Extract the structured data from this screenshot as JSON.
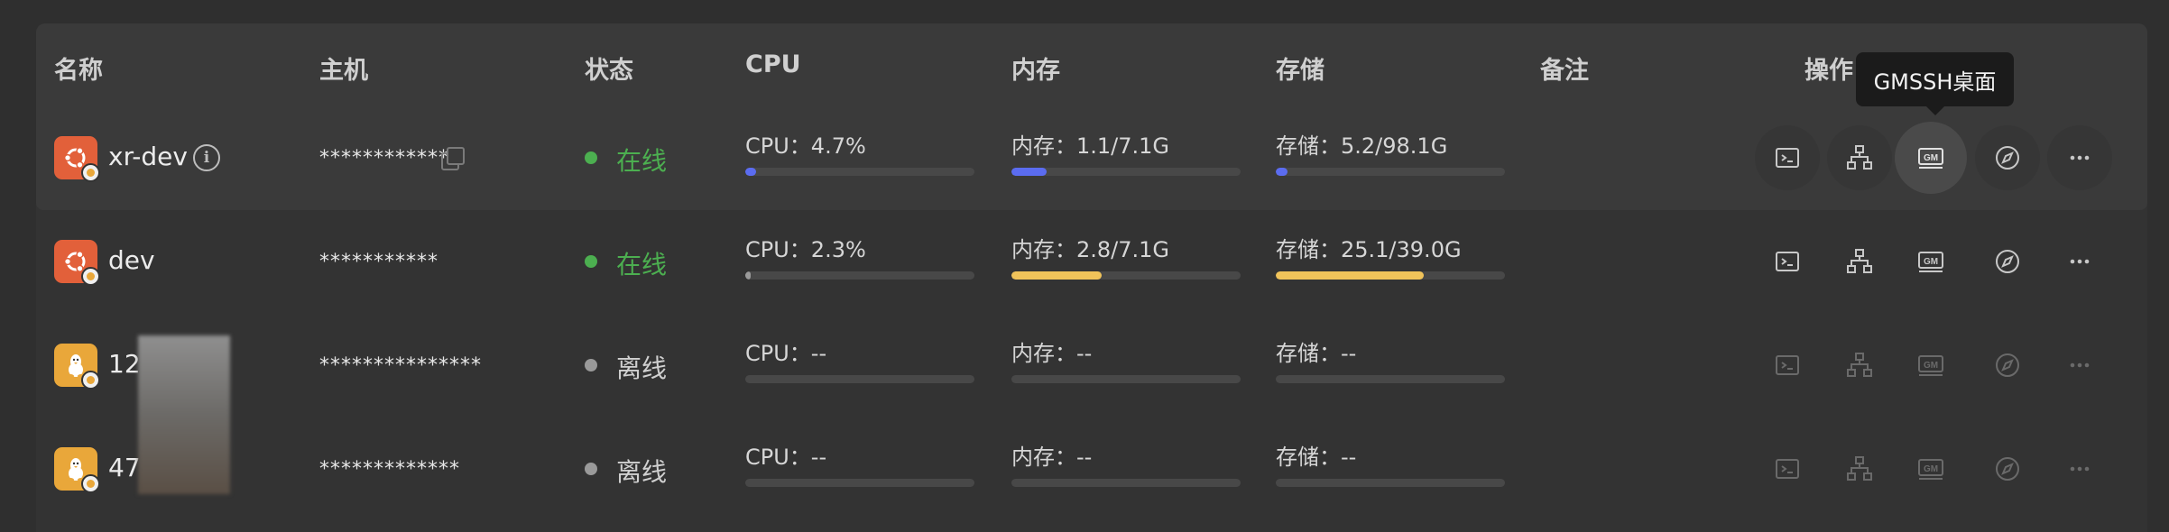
{
  "columns": {
    "name": "名称",
    "host": "主机",
    "status": "状态",
    "cpu": "CPU",
    "memory": "内存",
    "storage": "存储",
    "remark": "备注",
    "actions": "操作"
  },
  "tooltip": "GMSSH桌面",
  "colors": {
    "online": "#4caf50",
    "offline": "#9a9a9a",
    "bar_blue": "#5b6cf0",
    "bar_yellow": "#f0c35a",
    "bar_track": "#484848"
  },
  "rows": [
    {
      "os": "ubuntu-icon",
      "name": "xr-dev",
      "host": "************",
      "status": "在线",
      "online": true,
      "cpu": "CPU：4.7%",
      "cpu_pct": 4.7,
      "memory": "内存：1.1/7.1G",
      "memory_pct": 15.5,
      "storage": "存储：5.2/98.1G",
      "storage_pct": 5.3
    },
    {
      "os": "ubuntu-icon",
      "name": "dev",
      "host": "***********",
      "status": "在线",
      "online": true,
      "cpu": "CPU：2.3%",
      "cpu_pct": 2.3,
      "memory": "内存：2.8/7.1G",
      "memory_pct": 39.4,
      "storage": "存储：25.1/39.0G",
      "storage_pct": 64.4
    },
    {
      "os": "linux-icon",
      "name": "12",
      "host": "***************",
      "status": "离线",
      "online": false,
      "cpu": "CPU：--",
      "memory": "内存：--",
      "storage": "存储：--"
    },
    {
      "os": "linux-icon",
      "name": "47",
      "host": "*************",
      "status": "离线",
      "online": false,
      "cpu": "CPU：--",
      "memory": "内存：--",
      "storage": "存储：--"
    }
  ],
  "action_icons": [
    "terminal-icon",
    "network-icon",
    "gm-desktop-icon",
    "compass-icon",
    "more-icon"
  ]
}
